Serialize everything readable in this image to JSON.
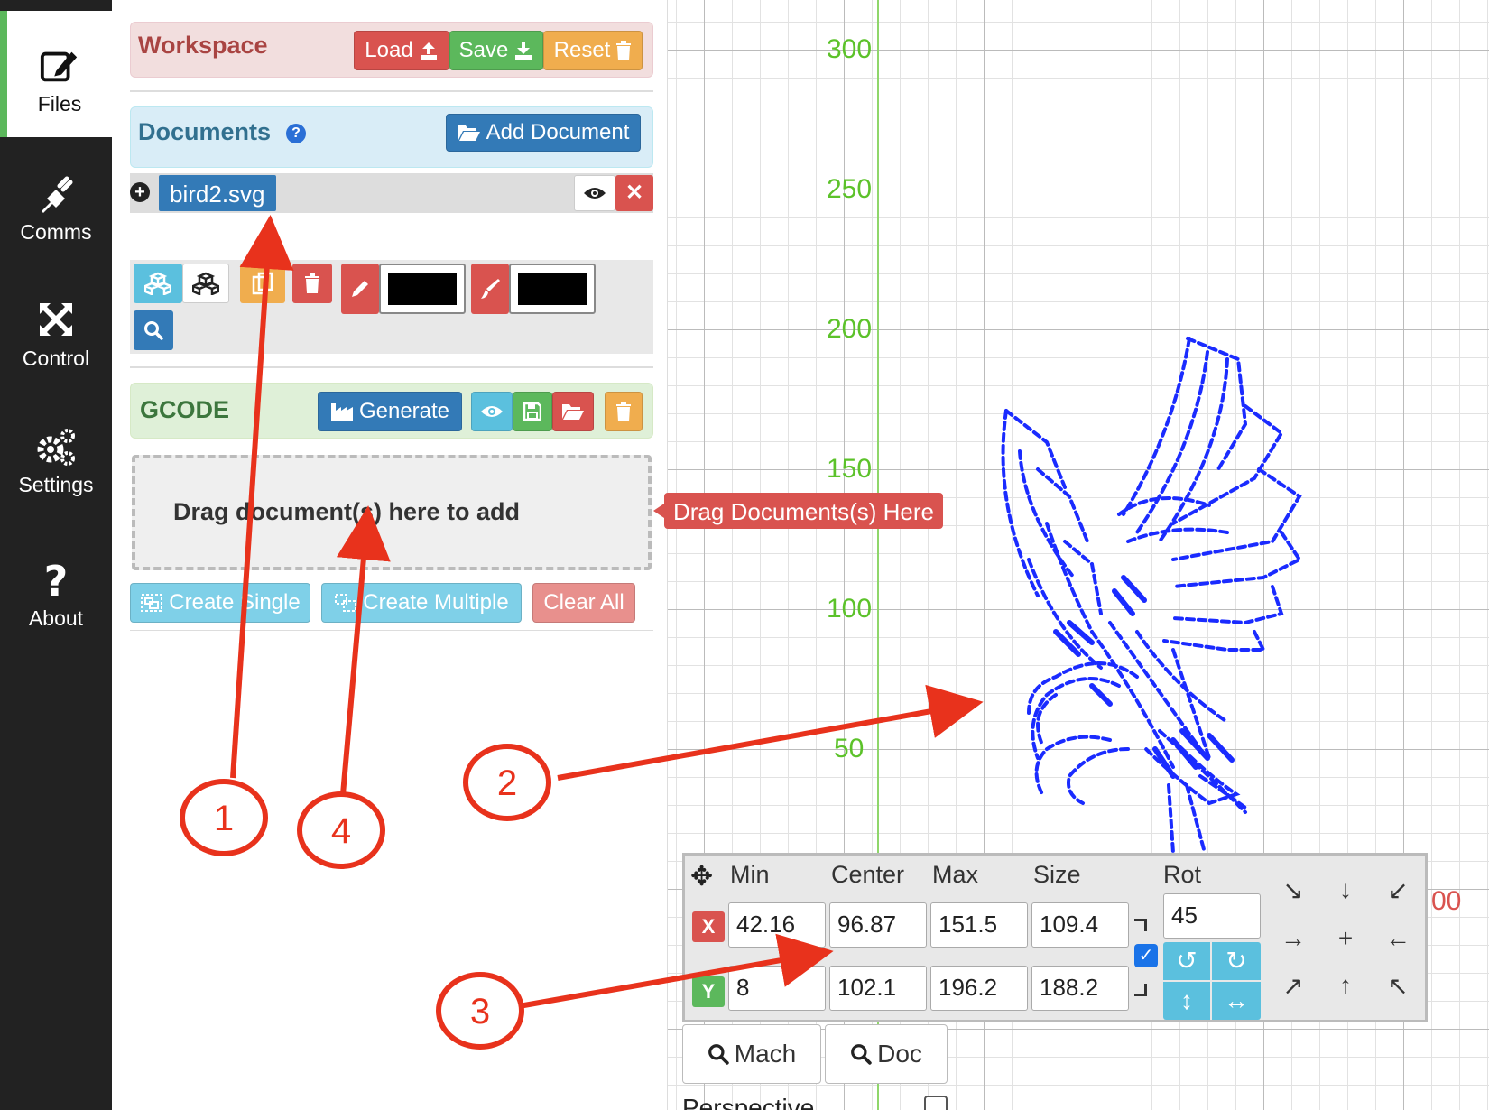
{
  "sidebar": {
    "items": [
      {
        "label": "Files",
        "icon": "edit-icon"
      },
      {
        "label": "Comms",
        "icon": "plug-icon"
      },
      {
        "label": "Control",
        "icon": "arrows-icon"
      },
      {
        "label": "Settings",
        "icon": "gears-icon"
      },
      {
        "label": "About",
        "icon": "question-icon"
      }
    ]
  },
  "workspace": {
    "title": "Workspace",
    "load_label": "Load",
    "save_label": "Save",
    "reset_label": "Reset"
  },
  "documents": {
    "title": "Documents",
    "add_label": "Add Document",
    "items": [
      {
        "name": "bird2.svg"
      }
    ]
  },
  "gcode": {
    "title": "GCODE",
    "generate_label": "Generate",
    "drop_text": "Drag document(s) here to add",
    "create_single_label": "Create Single",
    "create_multiple_label": "Create Multiple",
    "clear_all_label": "Clear All"
  },
  "tooltip": {
    "text": "Drag Documents(s) Here"
  },
  "grid": {
    "y_labels": [
      "300",
      "250",
      "200",
      "150",
      "100",
      "50"
    ],
    "x_label_partial": "00"
  },
  "transform": {
    "headers": {
      "min": "Min",
      "center": "Center",
      "max": "Max",
      "size": "Size",
      "rot": "Rot"
    },
    "x_label": "X",
    "y_label": "Y",
    "x": {
      "min": "42.16",
      "center": "96.87",
      "max": "151.5",
      "size": "109.4"
    },
    "y": {
      "min": "8",
      "center": "102.1",
      "max": "196.2",
      "size": "188.2"
    },
    "rot": "45",
    "lock_aspect": true
  },
  "footer": {
    "mach_label": "Mach",
    "doc_label": "Doc",
    "perspective_label": "Perspective"
  },
  "annotations": {
    "callouts": [
      "1",
      "2",
      "3",
      "4"
    ]
  },
  "colors": {
    "danger": "#d9534f",
    "success": "#5cb85c",
    "warning": "#f0ad4e",
    "primary": "#337ab7",
    "info": "#5bc0de",
    "drawing": "#1a2bff",
    "annotation": "#e8321c"
  }
}
